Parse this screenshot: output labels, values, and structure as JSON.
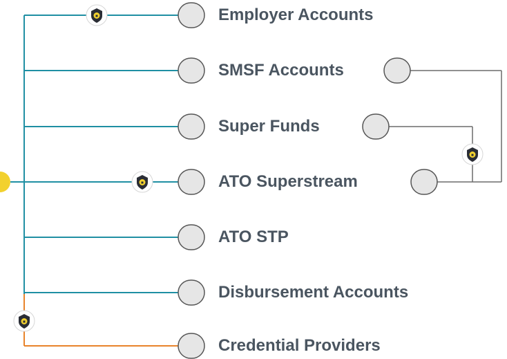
{
  "colors": {
    "teal": "#1f8fa3",
    "orange": "#e8832a",
    "gray": "#6b6b6b",
    "node_fill": "#e6e6e6",
    "node_stroke": "#555555",
    "hub_yellow": "#f2d12e",
    "label_text": "#4a5560"
  },
  "icons": {
    "lock_shield": "shield-lock-icon"
  },
  "nodes": [
    {
      "id": "employer",
      "label": "Employer Accounts"
    },
    {
      "id": "smsf",
      "label": "SMSF Accounts"
    },
    {
      "id": "superfunds",
      "label": "Super Funds"
    },
    {
      "id": "ato-superstream",
      "label": "ATO Superstream"
    },
    {
      "id": "ato-stp",
      "label": "ATO STP"
    },
    {
      "id": "disbursement",
      "label": "Disbursement Accounts"
    },
    {
      "id": "credential",
      "label": "Credential Providers"
    }
  ]
}
